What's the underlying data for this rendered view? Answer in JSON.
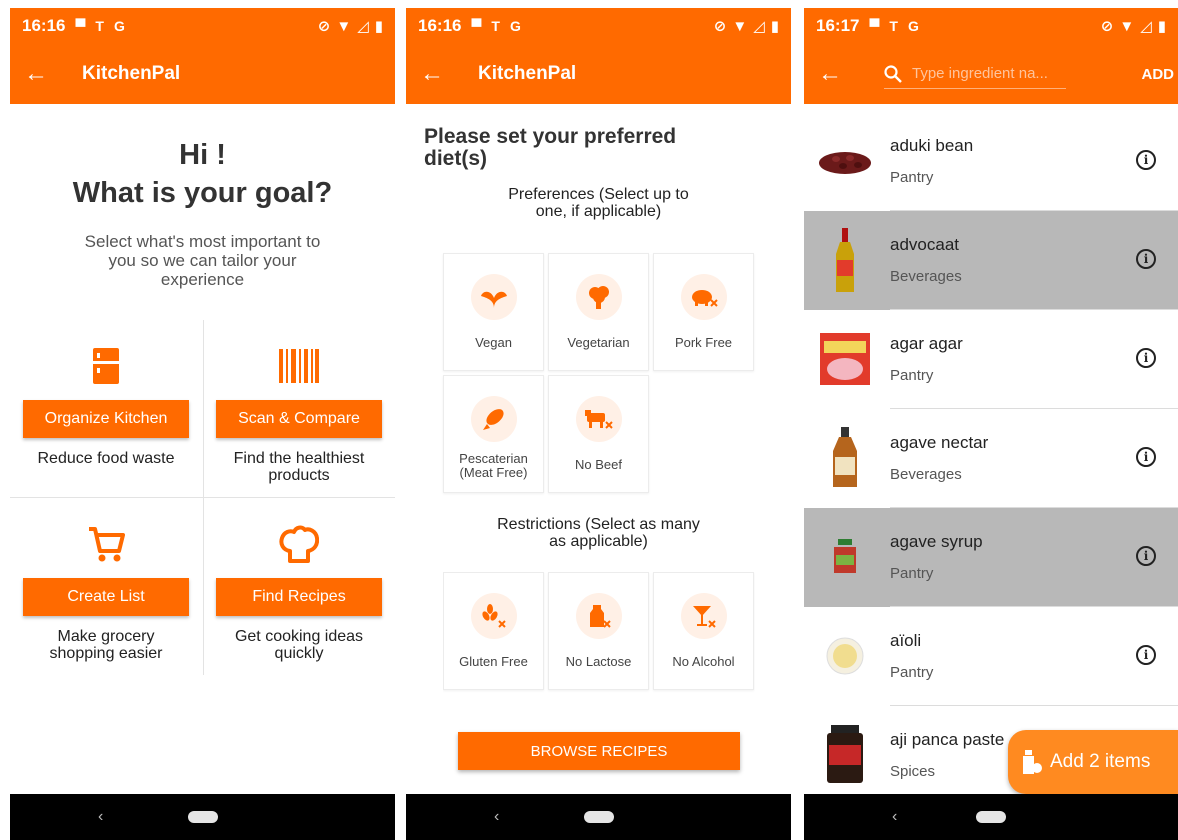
{
  "colors": {
    "primary": "#ff6a00",
    "tile_bg": "#fff0e6",
    "selected_row": "#b8b8b8"
  },
  "screen1": {
    "status": {
      "time": "16:16",
      "icons": [
        "image-icon",
        "t-icon",
        "g-icon"
      ]
    },
    "app_title": "KitchenPal",
    "greeting": "Hi !",
    "question": "What is your goal?",
    "subtitle": "Select what's most important to you so we can tailor your experience",
    "goals": [
      {
        "icon": "fridge-icon",
        "button": "Organize Kitchen",
        "desc": "Reduce food waste"
      },
      {
        "icon": "barcode-icon",
        "button": "Scan & Compare",
        "desc": "Find the healthiest products"
      },
      {
        "icon": "cart-icon",
        "button": "Create List",
        "desc": "Make grocery shopping easier"
      },
      {
        "icon": "chef-hat-icon",
        "button": "Find Recipes",
        "desc": "Get cooking ideas quickly"
      }
    ]
  },
  "screen2": {
    "status": {
      "time": "16:16"
    },
    "app_title": "KitchenPal",
    "heading": "Please set your preferred diet(s)",
    "preferences_label": "Preferences (Select up to one, if applicable)",
    "preferences": [
      {
        "icon": "leaf-icon",
        "label": "Vegan"
      },
      {
        "icon": "broccoli-icon",
        "label": "Vegetarian"
      },
      {
        "icon": "pig-crossed-icon",
        "label": "Pork Free"
      },
      {
        "icon": "fish-icon",
        "label": "Pescaterian (Meat Free)"
      },
      {
        "icon": "cow-crossed-icon",
        "label": "No Beef"
      }
    ],
    "restrictions_label": "Restrictions (Select as many as applicable)",
    "restrictions": [
      {
        "icon": "wheat-crossed-icon",
        "label": "Gluten Free"
      },
      {
        "icon": "milk-crossed-icon",
        "label": "No Lactose"
      },
      {
        "icon": "cocktail-crossed-icon",
        "label": "No Alcohol"
      }
    ],
    "browse_button": "BROWSE RECIPES"
  },
  "screen3": {
    "status": {
      "time": "16:17"
    },
    "search_placeholder": "Type ingredient na...",
    "add_label": "ADD",
    "items": [
      {
        "name": "aduki bean",
        "category": "Pantry",
        "selected": false,
        "thumb": "beans-icon"
      },
      {
        "name": "advocaat",
        "category": "Beverages",
        "selected": true,
        "thumb": "bottle-icon"
      },
      {
        "name": "agar agar",
        "category": "Pantry",
        "selected": false,
        "thumb": "box-icon"
      },
      {
        "name": "agave nectar",
        "category": "Beverages",
        "selected": false,
        "thumb": "syrup-bottle-icon"
      },
      {
        "name": "agave syrup",
        "category": "Pantry",
        "selected": true,
        "thumb": "jar-icon"
      },
      {
        "name": "aïoli",
        "category": "Pantry",
        "selected": false,
        "thumb": "bowl-icon"
      },
      {
        "name": "aji panca paste",
        "category": "Spices",
        "selected": false,
        "thumb": "jar-dark-icon"
      }
    ],
    "fab_label": "Add 2 items"
  }
}
